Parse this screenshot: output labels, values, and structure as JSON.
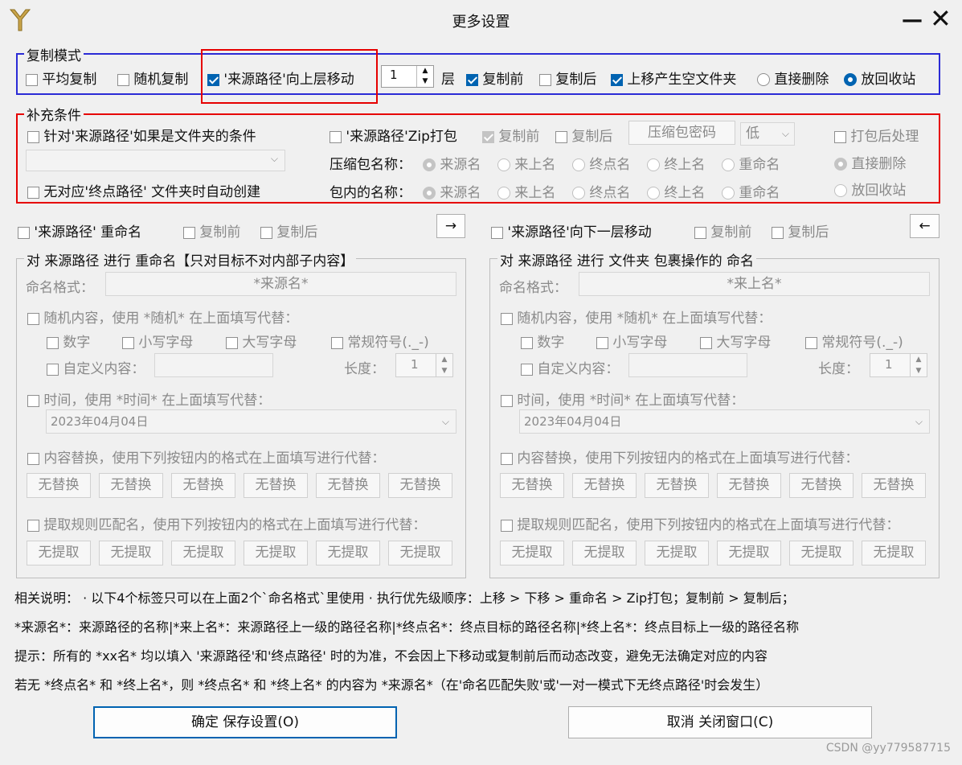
{
  "window": {
    "title": "更多设置",
    "minimize": "—",
    "close": "✕"
  },
  "copy_mode": {
    "legend": "复制模式",
    "avg_copy": "平均复制",
    "random_copy": "随机复制",
    "move_up": "'来源路径'向上层移动",
    "levels_value": "1",
    "levels_unit": "层",
    "before_copy": "复制前",
    "after_copy": "复制后",
    "empty_folder": "上移产生空文件夹",
    "delete_direct": "直接删除",
    "recycle": "放回收站"
  },
  "extra": {
    "legend": "补充条件",
    "folder_cond": "针对'来源路径'如果是文件夹的条件",
    "zip": "'来源路径'Zip打包",
    "zip_before": "复制前",
    "zip_after": "复制后",
    "zip_password": "压缩包密码",
    "zip_level": "低",
    "post_process": "打包后处理",
    "post_delete": "直接删除",
    "post_recycle": "放回收站",
    "auto_create": "无对应'终点路径' 文件夹时自动创建",
    "zip_name_label": "压缩包名称：",
    "inner_name_label": "包内的名称：",
    "name_options": [
      "来源名",
      "来上名",
      "终点名",
      "终上名",
      "重命名"
    ]
  },
  "left": {
    "rename_check": "'来源路径' 重命名",
    "before": "复制前",
    "after": "复制后",
    "arrow": "→",
    "legend": "对 来源路径 进行 重命名【只对目标不对内部子内容】",
    "format_label": "命名格式：",
    "format_value": "*来源名*",
    "random_label": "随机内容，使用 *随机* 在上面填写代替：",
    "digits": "数字",
    "lower": "小写字母",
    "upper": "大写字母",
    "symbols": "常规符号(._-)",
    "custom": "自定义内容：",
    "length_label": "长度：",
    "length_value": "1",
    "time_label": "时间，使用 *时间* 在上面填写代替：",
    "date_value": "2023年04月04日",
    "replace_label": "内容替换，使用下列按钮内的格式在上面填写进行代替：",
    "replace_buttons": [
      "无替换",
      "无替换",
      "无替换",
      "无替换",
      "无替换",
      "无替换"
    ],
    "extract_label": "提取规则匹配名，使用下列按钮内的格式在上面填写进行代替：",
    "extract_buttons": [
      "无提取",
      "无提取",
      "无提取",
      "无提取",
      "无提取",
      "无提取"
    ]
  },
  "right": {
    "move_down_check": "'来源路径'向下一层移动",
    "before": "复制前",
    "after": "复制后",
    "arrow": "←",
    "legend": "对 来源路径 进行 文件夹 包裹操作的 命名",
    "format_label": "命名格式：",
    "format_value": "*来上名*",
    "random_label": "随机内容，使用 *随机* 在上面填写代替：",
    "digits": "数字",
    "lower": "小写字母",
    "upper": "大写字母",
    "symbols": "常规符号(._-)",
    "custom": "自定义内容：",
    "length_label": "长度：",
    "length_value": "1",
    "time_label": "时间，使用 *时间* 在上面填写代替：",
    "date_value": "2023年04月04日",
    "replace_label": "内容替换，使用下列按钮内的格式在上面填写进行代替：",
    "replace_buttons": [
      "无替换",
      "无替换",
      "无替换",
      "无替换",
      "无替换",
      "无替换"
    ],
    "extract_label": "提取规则匹配名，使用下列按钮内的格式在上面填写进行代替：",
    "extract_buttons": [
      "无提取",
      "无提取",
      "无提取",
      "无提取",
      "无提取",
      "无提取"
    ]
  },
  "notes": [
    "相关说明：  · 以下4个标签只可以在上面2个`命名格式`里使用  · 执行优先级顺序：上移 > 下移 > 重命名 > Zip打包；复制前 > 复制后；",
    "*来源名*：来源路径的名称|*来上名*：来源路径上一级的路径名称|*终点名*：终点目标的路径名称|*终上名*：终点目标上一级的路径名称",
    "提示：所有的 *xx名* 均以填入 '来源路径'和'终点路径' 时的为准，不会因上下移动或复制前后而动态改变，避免无法确定对应的内容",
    "若无 *终点名* 和 *终上名*，则 *终点名* 和 *终上名* 的内容为 *来源名*（在'命名匹配失败'或'一对一模式下无终点路径'时会发生）"
  ],
  "ok_button": "确定 保存设置(O)",
  "cancel_button": "取消 关闭窗口(C)",
  "watermark": "CSDN @yy779587715"
}
